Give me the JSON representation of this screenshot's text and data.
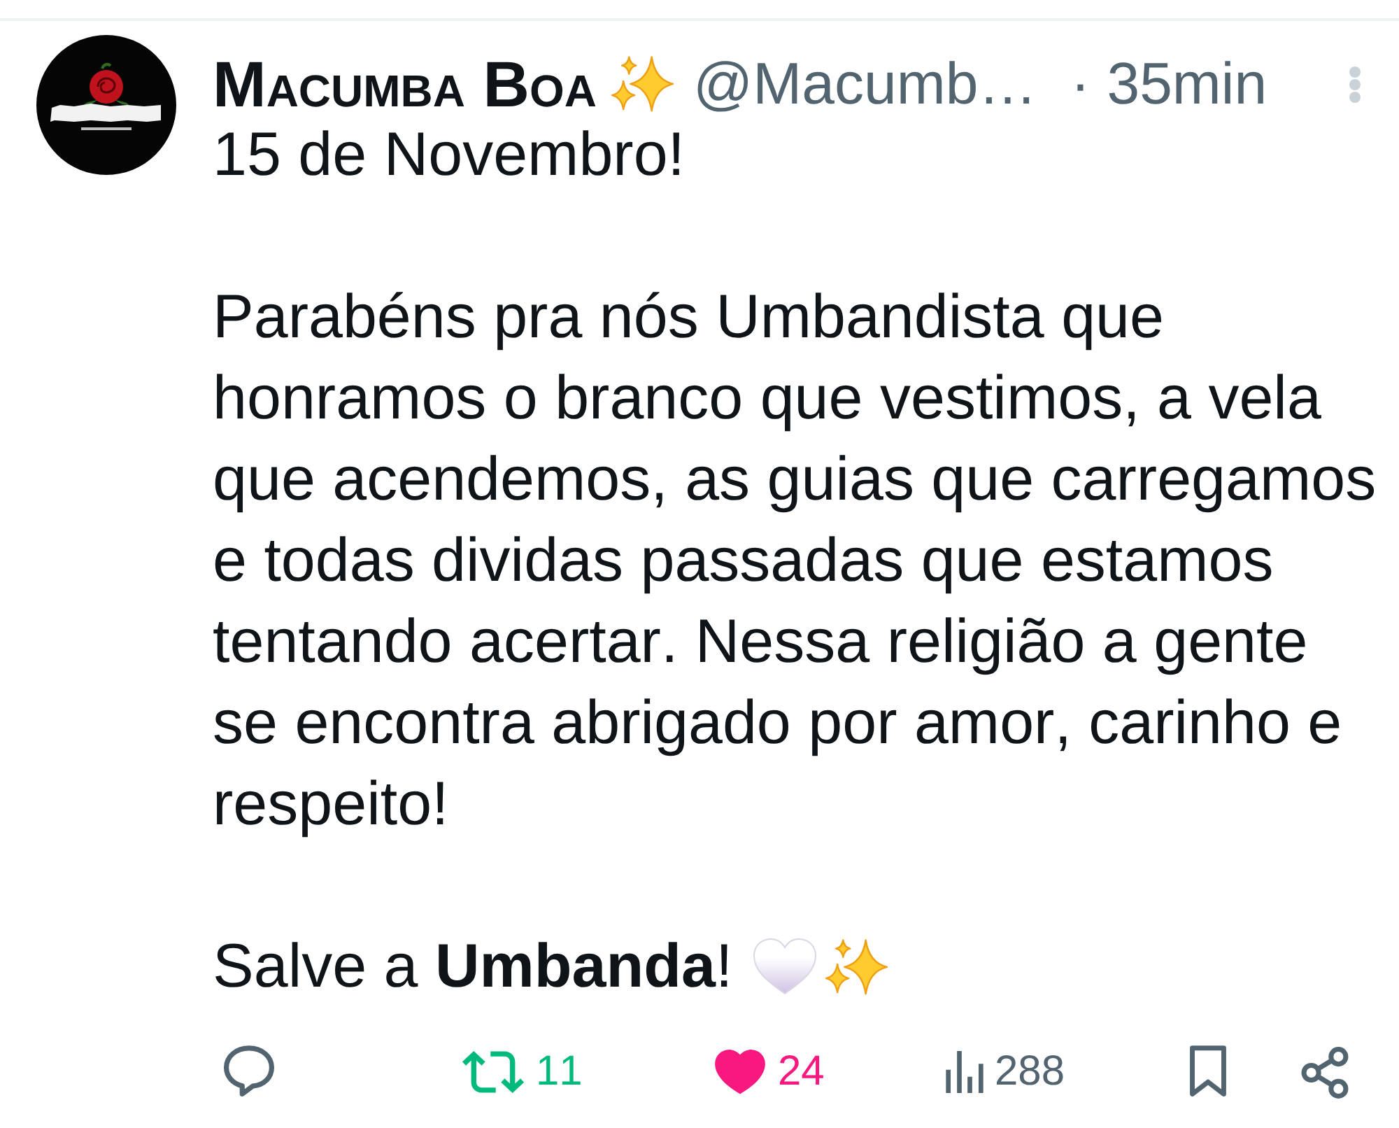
{
  "post": {
    "author": {
      "display_name": "Macumba Boa",
      "handle": "@Macumb…",
      "separator": "·",
      "time": "35min"
    },
    "paragraphs": [
      "15 de Novembro!",
      "Parabéns pra nós Umbandista que honramos o branco que vestimos, a vela que acendemos, as guias que carregamos e todas dividas passadas que estamos tentando acertar. Nessa religião a gente se encontra abrigado por amor, carinho e respeito!",
      "Salve a **Umbanda**!"
    ],
    "actions": [
      {
        "kind": "reply"
      },
      {
        "kind": "repost",
        "count": "11",
        "active": true
      },
      {
        "kind": "like",
        "count": "24",
        "active": true
      },
      {
        "kind": "views",
        "count": "288"
      },
      {
        "kind": "bookmark",
        "active": false
      },
      {
        "kind": "share"
      }
    ]
  }
}
